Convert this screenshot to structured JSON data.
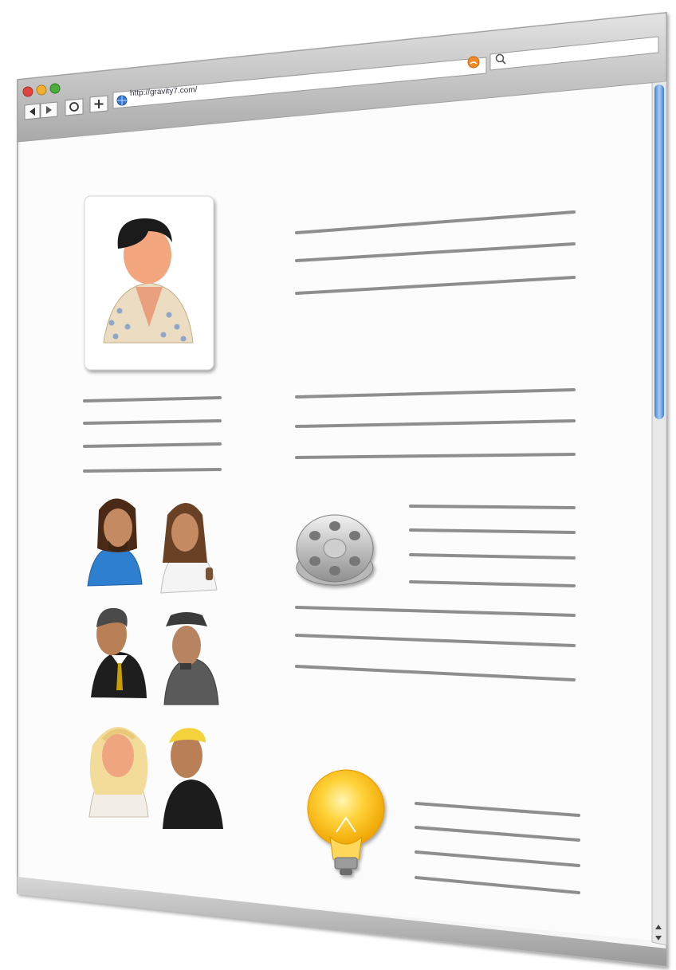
{
  "browser": {
    "url": "http://gravity7.com/",
    "colors": {
      "chrome": "#c9c9c9",
      "close": "#e0443e",
      "minimize": "#f0b02f",
      "zoom": "#4cae3a",
      "scroll_thumb": "#6ea5e8",
      "rss": "#f08a24",
      "line": "#8e8e8e"
    },
    "icons": [
      "back-icon",
      "forward-icon",
      "reload-icon",
      "add-icon",
      "globe-icon",
      "rss-icon",
      "search-icon"
    ]
  },
  "content": {
    "icons": [
      "user-elvis-icon",
      "user-longhair-man-icon",
      "user-woman-icon",
      "user-businessman-icon",
      "user-hat-man-icon",
      "user-blonde-woman-icon",
      "user-blond-man-icon",
      "film-reel-icon",
      "lightbulb-icon"
    ]
  }
}
